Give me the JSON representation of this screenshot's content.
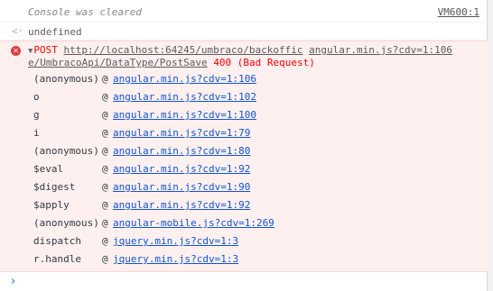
{
  "cleared": {
    "text": "Console was cleared",
    "source": "VM600:1"
  },
  "result": {
    "icon": "return-arrow-icon",
    "text": "undefined"
  },
  "error": {
    "icon": "error-circle-icon",
    "method": "POST",
    "url": "http://localhost:64245/umbraco/backoffic",
    "source_line1": "angular.min.js?cdv=1:106",
    "url_cont": "e/UmbracoApi/DataType/PostSave",
    "status": "400 (Bad Request)",
    "frames": [
      {
        "fn": "(anonymous)",
        "at": "@",
        "link": "angular.min.js?cdv=1:106"
      },
      {
        "fn": "o",
        "at": "@",
        "link": "angular.min.js?cdv=1:102"
      },
      {
        "fn": "g",
        "at": "@",
        "link": "angular.min.js?cdv=1:100"
      },
      {
        "fn": "i",
        "at": "@",
        "link": "angular.min.js?cdv=1:79"
      },
      {
        "fn": "(anonymous)",
        "at": "@",
        "link": "angular.min.js?cdv=1:80"
      },
      {
        "fn": "$eval",
        "at": "@",
        "link": "angular.min.js?cdv=1:92"
      },
      {
        "fn": "$digest",
        "at": "@",
        "link": "angular.min.js?cdv=1:90"
      },
      {
        "fn": "$apply",
        "at": "@",
        "link": "angular.min.js?cdv=1:92"
      },
      {
        "fn": "(anonymous)",
        "at": "@",
        "link": "angular-mobile.js?cdv=1:269"
      },
      {
        "fn": "dispatch",
        "at": "@",
        "link": "jquery.min.js?cdv=1:3"
      },
      {
        "fn": "r.handle",
        "at": "@",
        "link": "jquery.min.js?cdv=1:3"
      }
    ]
  },
  "prompt": {
    "icon": "prompt-chevron-icon",
    "symbol": "›"
  },
  "colors": {
    "error_bg": "#fff0f0",
    "error_text": "#ff0000",
    "link": "#1155cc"
  }
}
